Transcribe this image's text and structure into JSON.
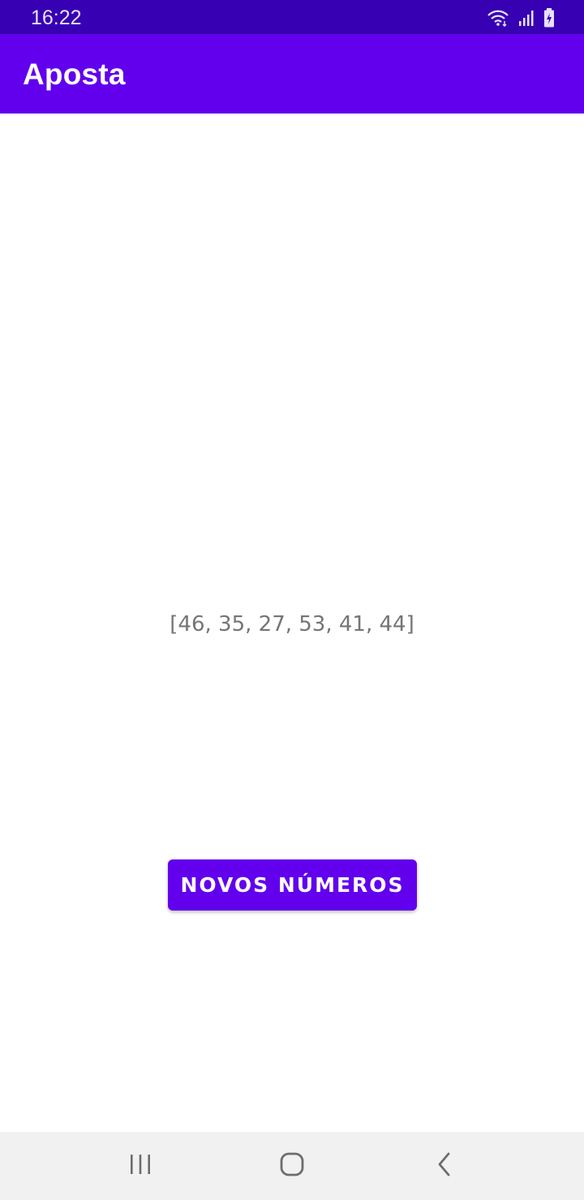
{
  "status_bar": {
    "time": "16:22",
    "icons": [
      "wifi-icon",
      "signal-icon",
      "battery-icon"
    ]
  },
  "app_bar": {
    "title": "Aposta"
  },
  "main": {
    "numbers_text": "[46, 35, 27, 53, 41, 44]",
    "new_numbers_button_label": "NOVOS NÚMEROS"
  },
  "nav_bar": {
    "buttons": [
      "recent-apps-icon",
      "home-icon",
      "back-icon"
    ]
  },
  "colors": {
    "primary": "#6200ee",
    "primary_dark": "#3700b3",
    "text_secondary": "#757575",
    "nav_background": "#f1f1f1"
  }
}
